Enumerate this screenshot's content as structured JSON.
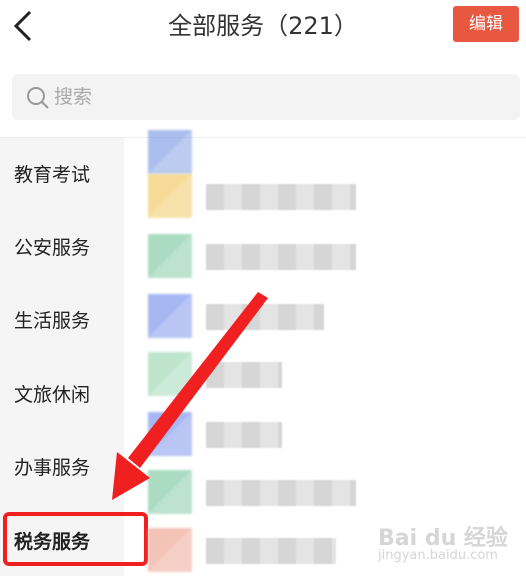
{
  "header": {
    "title": "全部服务（221）",
    "edit_label": "编辑"
  },
  "search": {
    "placeholder": "搜索"
  },
  "sidebar": {
    "categories": [
      {
        "label": "教育考试",
        "active": false
      },
      {
        "label": "公安服务",
        "active": false
      },
      {
        "label": "生活服务",
        "active": false
      },
      {
        "label": "文旅休闲",
        "active": false
      },
      {
        "label": "办事服务",
        "active": false
      },
      {
        "label": "税务服务",
        "active": true
      }
    ]
  },
  "services": {
    "icon_colors": [
      "#8fa8e6",
      "#f2cf74",
      "#8fd0ad",
      "#8aa0ee",
      "#a9dcbc",
      "#8aa0ee",
      "#8fd0ad",
      "#f0b0a0"
    ]
  },
  "watermark": {
    "brand": "Bai du 经验",
    "url": "jingyan.baidu.com"
  },
  "colors": {
    "accent": "#e8573f",
    "highlight": "#f02020"
  }
}
